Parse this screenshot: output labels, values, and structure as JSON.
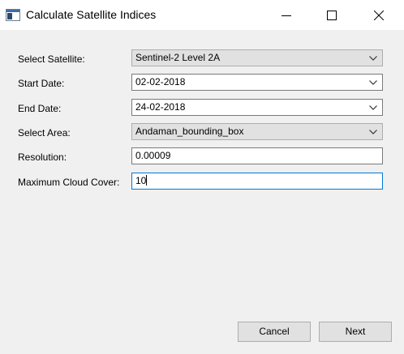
{
  "window": {
    "title": "Calculate Satellite Indices"
  },
  "form": {
    "satellite": {
      "label": "Select Satellite:",
      "value": "Sentinel-2 Level 2A"
    },
    "start_date": {
      "label": "Start Date:",
      "value": "02-02-2018"
    },
    "end_date": {
      "label": "End Date:",
      "value": "24-02-2018"
    },
    "area": {
      "label": "Select Area:",
      "value": "Andaman_bounding_box"
    },
    "resolution": {
      "label": "Resolution:",
      "value": "0.00009"
    },
    "cloud_cover": {
      "label": "Maximum Cloud Cover:",
      "value": "10"
    }
  },
  "buttons": {
    "cancel": "Cancel",
    "next": "Next"
  },
  "icons": {
    "app": "window-app-icon",
    "minimize": "minimize-icon",
    "maximize": "maximize-icon",
    "close": "close-icon",
    "dropdown": "chevron-down-icon"
  },
  "colors": {
    "focus_border": "#0078d7",
    "background": "#f0f0f0"
  }
}
